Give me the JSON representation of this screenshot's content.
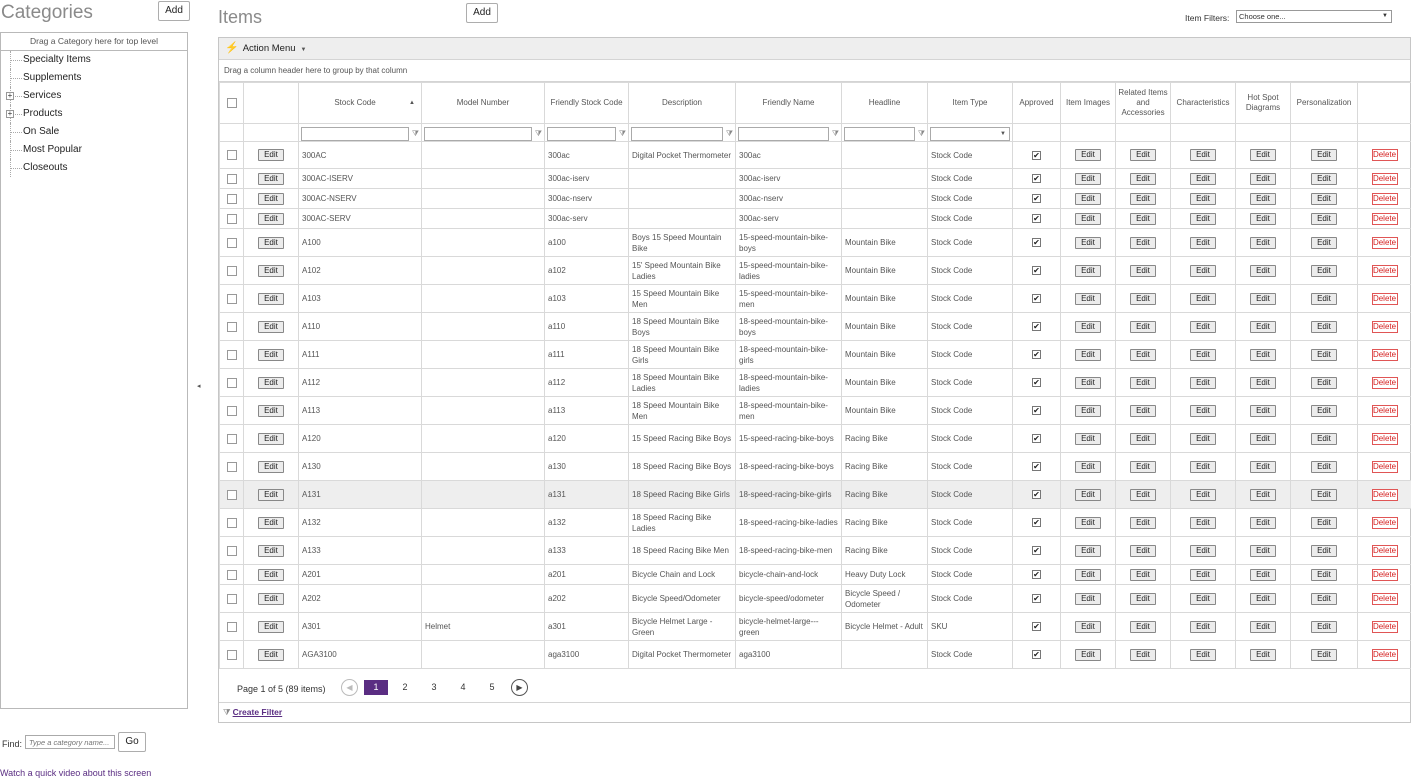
{
  "categories": {
    "title": "Categories",
    "add_label": "Add",
    "drop_hint": "Drag a Category here for top level",
    "items": [
      {
        "label": "Specialty Items",
        "expandable": false
      },
      {
        "label": "Supplements",
        "expandable": false
      },
      {
        "label": "Services",
        "expandable": true
      },
      {
        "label": "Products",
        "expandable": true
      },
      {
        "label": "On Sale",
        "expandable": false
      },
      {
        "label": "Most Popular",
        "expandable": false
      },
      {
        "label": "Closeouts",
        "expandable": false
      }
    ],
    "find_label": "Find:",
    "find_placeholder": "Type a category name...",
    "go_label": "Go",
    "video_link": "Watch a quick video about this screen"
  },
  "items_panel": {
    "title": "Items",
    "add_label": "Add",
    "filter_label": "Item Filters:",
    "filter_value": "Choose one...",
    "action_menu": "Action Menu",
    "group_hint": "Drag a column header here to group by that column",
    "columns": [
      "Stock Code",
      "Model Number",
      "Friendly Stock Code",
      "Description",
      "Friendly Name",
      "Headline",
      "Item Type",
      "Approved",
      "Item Images",
      "Related Items and Accessories",
      "Characteristics",
      "Hot Spot Diagrams",
      "Personalization"
    ],
    "edit_label": "Edit",
    "delete_label": "Delete",
    "rows": [
      {
        "stock": "300AC",
        "model": "",
        "friendly_stock": "300ac",
        "desc": "Digital Pocket Thermometer",
        "friendly_name": "300ac",
        "headline": "",
        "type": "Stock Code"
      },
      {
        "stock": "300AC-ISERV",
        "model": "",
        "friendly_stock": "300ac-iserv",
        "desc": "",
        "friendly_name": "300ac-iserv",
        "headline": "",
        "type": "Stock Code"
      },
      {
        "stock": "300AC-NSERV",
        "model": "",
        "friendly_stock": "300ac-nserv",
        "desc": "",
        "friendly_name": "300ac-nserv",
        "headline": "",
        "type": "Stock Code"
      },
      {
        "stock": "300AC-SERV",
        "model": "",
        "friendly_stock": "300ac-serv",
        "desc": "",
        "friendly_name": "300ac-serv",
        "headline": "",
        "type": "Stock Code"
      },
      {
        "stock": "A100",
        "model": "",
        "friendly_stock": "a100",
        "desc": "Boys 15 Speed Mountain Bike",
        "friendly_name": "15-speed-mountain-bike-boys",
        "headline": "Mountain Bike",
        "type": "Stock Code"
      },
      {
        "stock": "A102",
        "model": "",
        "friendly_stock": "a102",
        "desc": "15' Speed Mountain Bike Ladies",
        "friendly_name": "15-speed-mountain-bike-ladies",
        "headline": "Mountain Bike",
        "type": "Stock Code"
      },
      {
        "stock": "A103",
        "model": "",
        "friendly_stock": "a103",
        "desc": "15 Speed Mountain Bike Men",
        "friendly_name": "15-speed-mountain-bike-men",
        "headline": "Mountain Bike",
        "type": "Stock Code"
      },
      {
        "stock": "A110",
        "model": "",
        "friendly_stock": "a110",
        "desc": "18 Speed Mountain Bike Boys",
        "friendly_name": "18-speed-mountain-bike-boys",
        "headline": "Mountain Bike",
        "type": "Stock Code"
      },
      {
        "stock": "A111",
        "model": "",
        "friendly_stock": "a111",
        "desc": "18 Speed Mountain Bike Girls",
        "friendly_name": "18-speed-mountain-bike-girls",
        "headline": "Mountain Bike",
        "type": "Stock Code"
      },
      {
        "stock": "A112",
        "model": "",
        "friendly_stock": "a112",
        "desc": "18 Speed Mountain Bike Ladies",
        "friendly_name": "18-speed-mountain-bike-ladies",
        "headline": "Mountain Bike",
        "type": "Stock Code"
      },
      {
        "stock": "A113",
        "model": "",
        "friendly_stock": "a113",
        "desc": "18 Speed Mountain Bike Men",
        "friendly_name": "18-speed-mountain-bike-men",
        "headline": "Mountain Bike",
        "type": "Stock Code"
      },
      {
        "stock": "A120",
        "model": "",
        "friendly_stock": "a120",
        "desc": "15 Speed Racing Bike Boys",
        "friendly_name": "15-speed-racing-bike-boys",
        "headline": "Racing Bike",
        "type": "Stock Code"
      },
      {
        "stock": "A130",
        "model": "",
        "friendly_stock": "a130",
        "desc": "18 Speed Racing Bike Boys",
        "friendly_name": "18-speed-racing-bike-boys",
        "headline": "Racing Bike",
        "type": "Stock Code"
      },
      {
        "stock": "A131",
        "model": "",
        "friendly_stock": "a131",
        "desc": "18 Speed Racing Bike Girls",
        "friendly_name": "18-speed-racing-bike-girls",
        "headline": "Racing Bike",
        "type": "Stock Code"
      },
      {
        "stock": "A132",
        "model": "",
        "friendly_stock": "a132",
        "desc": "18 Speed Racing Bike Ladies",
        "friendly_name": "18-speed-racing-bike-ladies",
        "headline": "Racing Bike",
        "type": "Stock Code"
      },
      {
        "stock": "A133",
        "model": "",
        "friendly_stock": "a133",
        "desc": "18 Speed Racing Bike Men",
        "friendly_name": "18-speed-racing-bike-men",
        "headline": "Racing Bike",
        "type": "Stock Code"
      },
      {
        "stock": "A201",
        "model": "",
        "friendly_stock": "a201",
        "desc": "Bicycle Chain and Lock",
        "friendly_name": "bicycle-chain-and-lock",
        "headline": "Heavy Duty Lock",
        "type": "Stock Code"
      },
      {
        "stock": "A202",
        "model": "",
        "friendly_stock": "a202",
        "desc": "Bicycle Speed/Odometer",
        "friendly_name": "bicycle-speed/odometer",
        "headline": "Bicycle Speed / Odometer",
        "type": "Stock Code"
      },
      {
        "stock": "A301",
        "model": "Helmet",
        "friendly_stock": "a301",
        "desc": "Bicycle Helmet Large - Green",
        "friendly_name": "bicycle-helmet-large---green",
        "headline": "Bicycle Helmet - Adult",
        "type": "SKU"
      },
      {
        "stock": "AGA3100",
        "model": "",
        "friendly_stock": "aga3100",
        "desc": "Digital Pocket Thermometer",
        "friendly_name": "aga3100",
        "headline": "",
        "type": "Stock Code"
      }
    ],
    "pager": {
      "info": "Page 1 of 5 (89 items)",
      "pages": [
        "1",
        "2",
        "3",
        "4",
        "5"
      ],
      "current": "1"
    },
    "create_filter": "Create Filter"
  },
  "colors": {
    "accent": "#5a2d82",
    "delete": "#d42020",
    "bolt": "#e9a800"
  }
}
